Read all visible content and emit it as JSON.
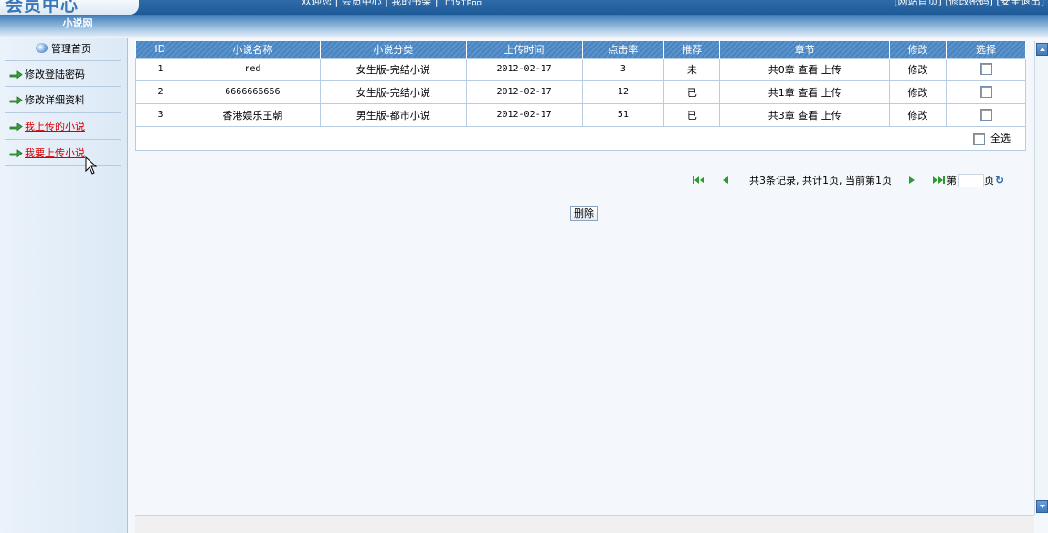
{
  "header": {
    "logo": "会员中心",
    "site_name": "小说网",
    "top_center_text": "欢迎您 | 会员中心 | 我的书架 | 上传作品",
    "top_right_text": "[网站首页] [修改密码] [安全退出]"
  },
  "sidebar": {
    "home_label": "管理首页",
    "items": [
      {
        "label": "修改登陆密码"
      },
      {
        "label": "修改详细资料"
      },
      {
        "label": "我上传的小说"
      },
      {
        "label": "我要上传小说"
      }
    ]
  },
  "table": {
    "headers": [
      "ID",
      "小说名称",
      "小说分类",
      "上传时间",
      "点击率",
      "推荐",
      "章节",
      "修改",
      "选择"
    ],
    "rows": [
      {
        "id": "1",
        "name": "red",
        "category": "女生版-完结小说",
        "date": "2012-02-17",
        "hits": "3",
        "recommend": "未",
        "chapters": "共0章",
        "view": "查看",
        "upload": "上传",
        "edit": "修改"
      },
      {
        "id": "2",
        "name": "6666666666",
        "category": "女生版-完结小说",
        "date": "2012-02-17",
        "hits": "12",
        "recommend": "已",
        "chapters": "共1章",
        "view": "查看",
        "upload": "上传",
        "edit": "修改"
      },
      {
        "id": "3",
        "name": "香港娱乐王朝",
        "category": "男生版-都市小说",
        "date": "2012-02-17",
        "hits": "51",
        "recommend": "已",
        "chapters": "共3章",
        "view": "查看",
        "upload": "上传",
        "edit": "修改"
      }
    ],
    "select_all_label": "全选"
  },
  "pager": {
    "summary": "共3条记录, 共计1页, 当前第1页",
    "page_prefix": "第",
    "page_suffix": "页",
    "page_value": ""
  },
  "actions": {
    "delete_label": "删除"
  },
  "colors": {
    "header_blue": "#4a84c0",
    "link_red": "#d40000",
    "arrow_green": "#2c9a2c"
  }
}
